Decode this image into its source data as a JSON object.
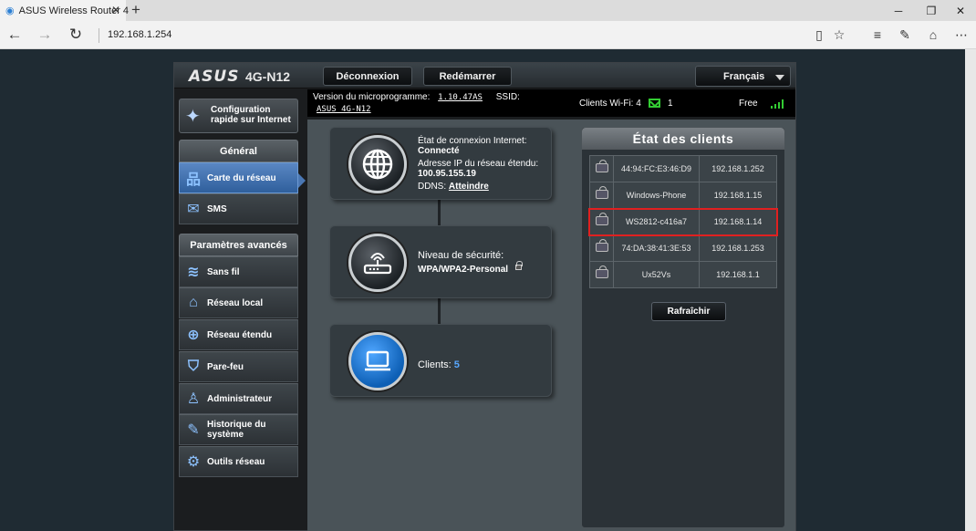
{
  "browser": {
    "tab_title": "ASUS Wireless Router 4",
    "url": "192.168.1.254",
    "icons": [
      "back-arrow-icon",
      "forward-arrow-icon",
      "refresh-icon",
      "reading-view-icon",
      "favorite-star-icon",
      "hub-icon",
      "web-note-icon",
      "share-icon",
      "more-icon"
    ]
  },
  "header": {
    "logo": "ASUS",
    "model": "4G-N12",
    "logout_label": "Déconnexion",
    "reboot_label": "Redémarrer",
    "language": "Français"
  },
  "infobar": {
    "fw_label": "Version du microprogramme:",
    "fw_version": "1.10.47AS",
    "ssid_label": "SSID:",
    "ssid_value": "ASUS_4G-N12",
    "clients_wifi": "Clients Wi-Fi: 4",
    "message_count": "1",
    "free": "Free"
  },
  "sidebar": {
    "quick_setup": "Configuration rapide sur Internet",
    "general_title": "Général",
    "general_items": [
      "Carte du réseau",
      "SMS"
    ],
    "advanced_title": "Paramètres avancés",
    "advanced_items": [
      "Sans fil",
      "Réseau local",
      "Réseau étendu",
      "Pare-feu",
      "Administrateur",
      "Historique du système",
      "Outils réseau"
    ]
  },
  "internet": {
    "status_label": "État de connexion Internet:",
    "status_value": "Connecté",
    "wan_ip_label": "Adresse IP du réseau étendu:",
    "wan_ip": "100.95.155.19",
    "ddns_label": "DDNS:",
    "ddns_link": "Atteindre"
  },
  "security": {
    "label": "Niveau de sécurité:",
    "value": "WPA/WPA2-Personal"
  },
  "clients": {
    "label": "Clients:",
    "count": "5"
  },
  "client_status": {
    "title": "État des clients",
    "rows": [
      {
        "name": "44:94:FC:E3:46:D9",
        "ip": "192.168.1.252"
      },
      {
        "name": "Windows-Phone",
        "ip": "192.168.1.15"
      },
      {
        "name": "WS2812-c416a7",
        "ip": "192.168.1.14"
      },
      {
        "name": "74:DA:38:41:3E:53",
        "ip": "192.168.1.253"
      },
      {
        "name": "Ux52Vs",
        "ip": "192.168.1.1"
      }
    ],
    "refresh_label": "Rafraîchir"
  },
  "colors": {
    "accent_blue": "#58a8ff",
    "active_menu": "#3f6ea9",
    "highlight_red": "#e02020",
    "signal_green": "#33cc33"
  }
}
